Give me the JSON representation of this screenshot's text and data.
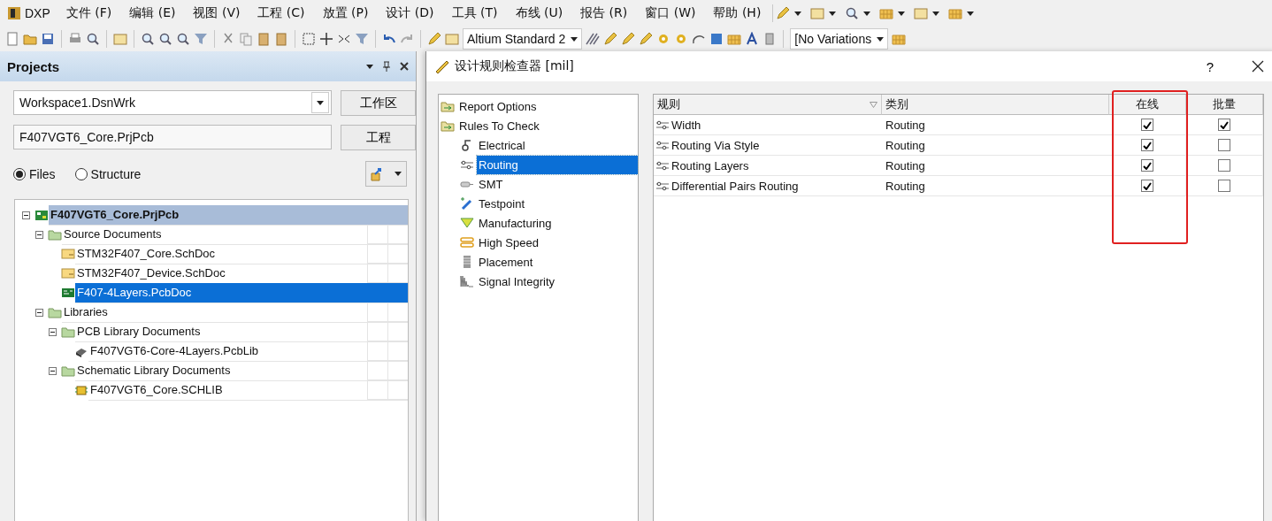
{
  "menu_bar": {
    "logo": "DXP",
    "items": [
      "文件 (F)",
      "编辑 (E)",
      "视图 (V)",
      "工程 (C)",
      "放置 (P)",
      "设计 (D)",
      "工具 (T)",
      "布线 (U)",
      "报告 (R)",
      "窗口 (W)",
      "帮助 (H)"
    ]
  },
  "toolbar": {
    "dropdowns": [
      {
        "value": "Altium Standard 2"
      },
      {
        "value": "[No Variations"
      }
    ]
  },
  "projects_panel": {
    "title": "Projects",
    "workspace": {
      "value": "Workspace1.DsnWrk",
      "button": "工作区"
    },
    "project": {
      "value": "F407VGT6_Core.PrjPcb",
      "button": "工程"
    },
    "view_modes": [
      {
        "label": "Files",
        "selected": true
      },
      {
        "label": "Structure",
        "selected": false
      }
    ],
    "tree": [
      {
        "label": "F407VGT6_Core.PrjPcb",
        "kind": "project",
        "selected": false,
        "active": true,
        "expanded": true,
        "children": [
          {
            "label": "Source Documents",
            "kind": "folder",
            "selected": false,
            "active": false,
            "expanded": true,
            "children": [
              {
                "label": "STM32F407_Core.SchDoc",
                "kind": "schdoc",
                "selected": false,
                "active": false
              },
              {
                "label": "STM32F407_Device.SchDoc",
                "kind": "schdoc",
                "selected": false,
                "active": false
              },
              {
                "label": "F407-4Layers.PcbDoc",
                "kind": "pcbdoc",
                "selected": true,
                "active": false
              }
            ]
          },
          {
            "label": "Libraries",
            "kind": "folder",
            "selected": false,
            "active": false,
            "expanded": true,
            "children": [
              {
                "label": "PCB Library Documents",
                "kind": "folder",
                "selected": false,
                "active": false,
                "expanded": true,
                "children": [
                  {
                    "label": "F407VGT6-Core-4Layers.PcbLib",
                    "kind": "pcblib",
                    "selected": false,
                    "active": false
                  }
                ]
              },
              {
                "label": "Schematic Library Documents",
                "kind": "folder",
                "selected": false,
                "active": false,
                "expanded": true,
                "children": [
                  {
                    "label": "F407VGT6_Core.SCHLIB",
                    "kind": "schlib",
                    "selected": false,
                    "active": false
                  }
                ]
              }
            ]
          }
        ]
      }
    ]
  },
  "dialog": {
    "title": "设计规则检查器 [mil]",
    "help": "?",
    "nav": [
      {
        "label": "Report Options",
        "kind": "folder",
        "selected": false
      },
      {
        "label": "Rules To Check",
        "kind": "folder",
        "selected": false,
        "children": [
          {
            "label": "Electrical",
            "kind": "electrical",
            "selected": false
          },
          {
            "label": "Routing",
            "kind": "routing",
            "selected": true
          },
          {
            "label": "SMT",
            "kind": "smt",
            "selected": false
          },
          {
            "label": "Testpoint",
            "kind": "testpoint",
            "selected": false
          },
          {
            "label": "Manufacturing",
            "kind": "manufacturing",
            "selected": false
          },
          {
            "label": "High Speed",
            "kind": "highspeed",
            "selected": false
          },
          {
            "label": "Placement",
            "kind": "placement",
            "selected": false
          },
          {
            "label": "Signal Integrity",
            "kind": "signal",
            "selected": false
          }
        ]
      }
    ],
    "table": {
      "columns": [
        {
          "label": "规则",
          "sortable": true,
          "highlighted": false
        },
        {
          "label": "类别",
          "sortable": false,
          "highlighted": false
        },
        {
          "label": "在线",
          "sortable": false,
          "highlighted": true
        },
        {
          "label": "批量",
          "sortable": false,
          "highlighted": false
        }
      ],
      "rows": [
        {
          "rule": "Width",
          "category": "Routing",
          "online": true,
          "batch": true
        },
        {
          "rule": "Routing Via Style",
          "category": "Routing",
          "online": true,
          "batch": false
        },
        {
          "rule": "Routing Layers",
          "category": "Routing",
          "online": true,
          "batch": false
        },
        {
          "rule": "Differential Pairs Routing",
          "category": "Routing",
          "online": true,
          "batch": false
        }
      ]
    }
  }
}
